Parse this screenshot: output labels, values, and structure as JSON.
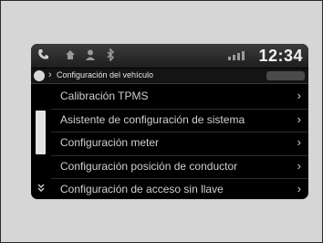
{
  "status_bar": {
    "time": "12:34",
    "icons": [
      "phone-icon",
      "home-icon",
      "user-icon",
      "bluetooth-icon",
      "signal-icon"
    ]
  },
  "title_bar": {
    "title": "Configuración del vehículo"
  },
  "menu": {
    "items": [
      {
        "label": "Calibración TPMS"
      },
      {
        "label": "Asistente de configuración de sistema"
      },
      {
        "label": "Configuración meter"
      },
      {
        "label": "Configuración posición de conductor"
      },
      {
        "label": "Configuración de acceso sin llave"
      }
    ]
  },
  "colors": {
    "screen_bg": "#000000",
    "text": "#cfcfcf",
    "frame_bg": "#d6d6d6"
  }
}
